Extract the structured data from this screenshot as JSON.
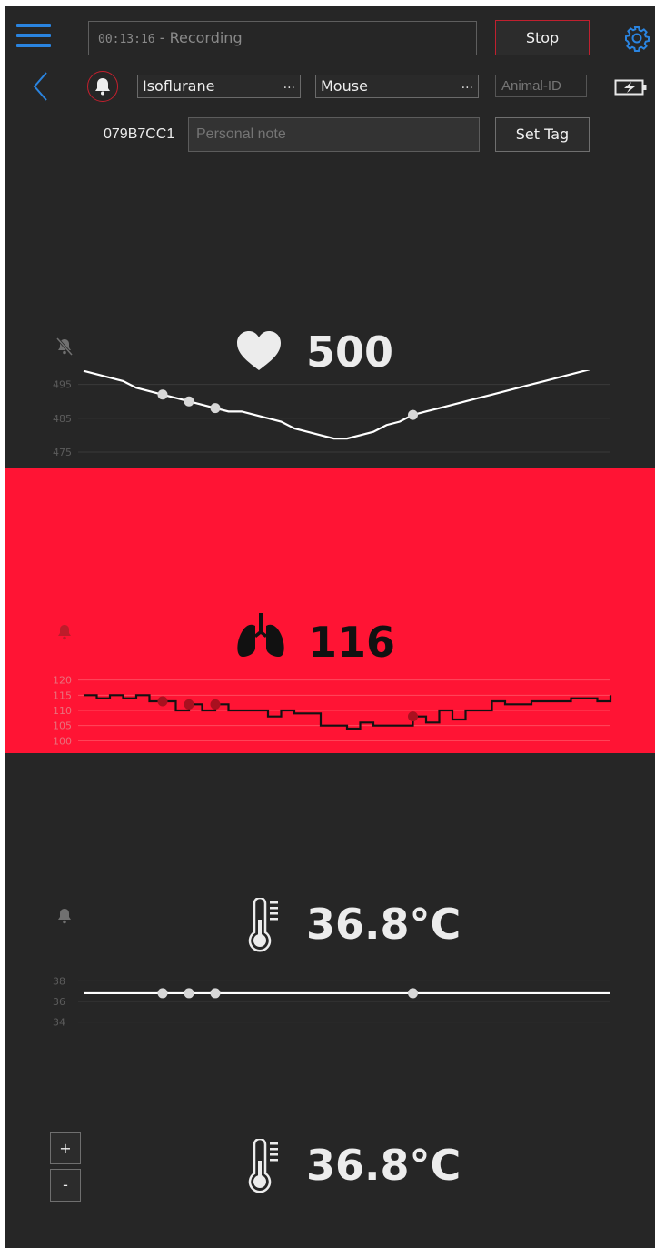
{
  "header": {
    "timer": "00:13:16",
    "status": " - Recording",
    "stop_label": "Stop",
    "anesthetic": "Isoflurane",
    "species": "Mouse",
    "ellipsis": "...",
    "animal_id_placeholder": "Animal-ID",
    "device_id": "079B7CC1",
    "note_placeholder": "Personal note",
    "set_tag_label": "Set Tag"
  },
  "metrics": {
    "heart_rate": {
      "value": "500",
      "icon": "heart-icon",
      "alarm": "muted",
      "y_ticks": [
        "495",
        "485",
        "475"
      ]
    },
    "respiration": {
      "value": "116",
      "icon": "lungs-icon",
      "alarm": "on",
      "alert_color": "#ff1434",
      "y_ticks": [
        "120",
        "115",
        "110",
        "105",
        "100"
      ]
    },
    "temperature": {
      "value": "36.8°C",
      "icon": "thermometer-icon",
      "alarm": "on",
      "y_ticks": [
        "38",
        "36",
        "34"
      ]
    },
    "temperature_2": {
      "value": "36.8°C",
      "icon": "thermometer-icon"
    }
  },
  "zoom": {
    "plus": "+",
    "minus": "-"
  },
  "colors": {
    "accent": "#2a84e0",
    "background": "#262626",
    "alert": "#ff1434"
  },
  "chart_data": [
    {
      "type": "line",
      "name": "heart-rate",
      "ylim": [
        470,
        500
      ],
      "y_ticks": [
        495,
        485,
        475
      ],
      "x": [
        0,
        1,
        2,
        3,
        4,
        5,
        6,
        7,
        8,
        9,
        10,
        11,
        12,
        13,
        14,
        15,
        16,
        17,
        18,
        19,
        20,
        21,
        22,
        23,
        24,
        25,
        26,
        27,
        28,
        29,
        30,
        31,
        32,
        33,
        34,
        35,
        36,
        37,
        38,
        39,
        40
      ],
      "values": [
        499,
        498,
        497,
        496,
        494,
        493,
        492,
        491,
        490,
        489,
        488,
        487,
        487,
        486,
        485,
        484,
        482,
        481,
        480,
        479,
        479,
        480,
        481,
        483,
        484,
        486,
        487,
        488,
        489,
        490,
        491,
        492,
        493,
        494,
        495,
        496,
        497,
        498,
        499,
        500,
        500
      ],
      "markers_x": [
        6,
        8,
        10,
        25
      ]
    },
    {
      "type": "line",
      "name": "respiration",
      "ylim": [
        98,
        122
      ],
      "y_ticks": [
        120,
        115,
        110,
        105,
        100
      ],
      "x": [
        0,
        1,
        2,
        3,
        4,
        5,
        6,
        7,
        8,
        9,
        10,
        11,
        12,
        13,
        14,
        15,
        16,
        17,
        18,
        19,
        20,
        21,
        22,
        23,
        24,
        25,
        26,
        27,
        28,
        29,
        30,
        31,
        32,
        33,
        34,
        35,
        36,
        37,
        38,
        39,
        40
      ],
      "values": [
        115,
        114,
        115,
        114,
        115,
        113,
        113,
        110,
        112,
        110,
        112,
        110,
        110,
        110,
        108,
        110,
        109,
        109,
        105,
        105,
        104,
        106,
        105,
        105,
        105,
        108,
        106,
        110,
        107,
        110,
        110,
        113,
        112,
        112,
        113,
        113,
        113,
        114,
        114,
        113,
        115
      ],
      "markers_x": [
        6,
        8,
        10,
        25
      ]
    },
    {
      "type": "line",
      "name": "temperature",
      "ylim": [
        33,
        39
      ],
      "y_ticks": [
        38,
        36,
        34
      ],
      "x": [
        0,
        40
      ],
      "values": [
        36.8,
        36.8
      ],
      "markers_x": [
        6,
        8,
        10,
        25
      ]
    }
  ]
}
